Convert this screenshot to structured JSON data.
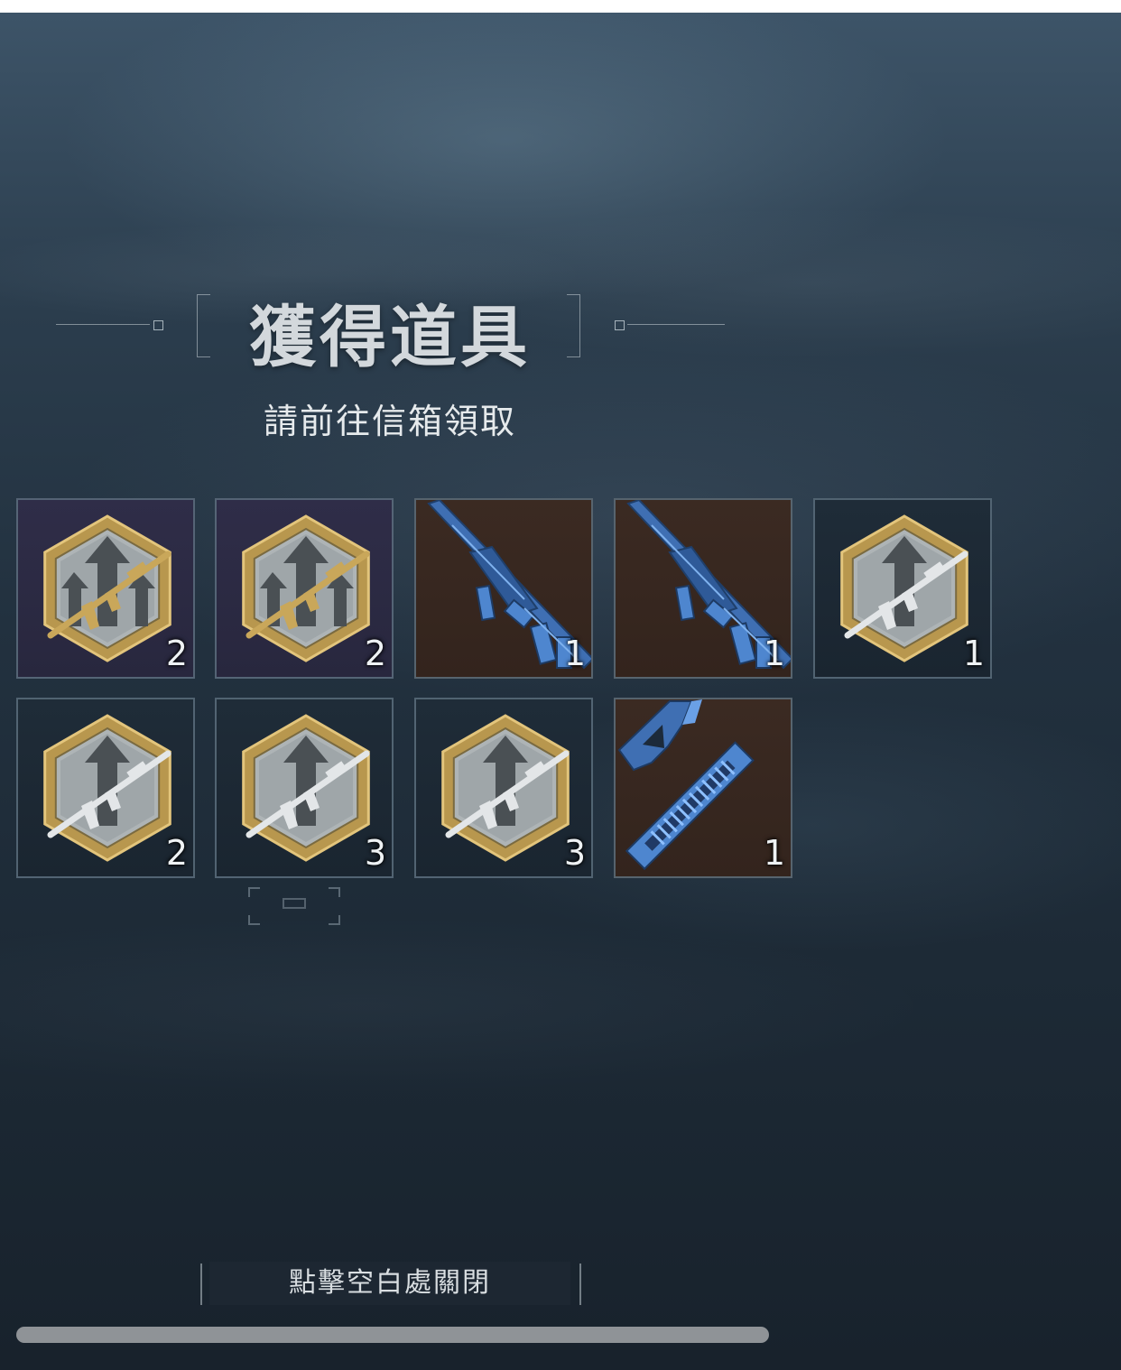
{
  "dialog": {
    "title": "獲得道具",
    "subtitle": "請前往信箱領取",
    "close_hint": "點擊空白處關閉"
  },
  "items": [
    {
      "name": "gold-rifle-upgrade-badge",
      "rarity_bg": "purple",
      "quantity": "2",
      "icon": "gold-upgrade-badge-icon"
    },
    {
      "name": "gold-rifle-upgrade-badge",
      "rarity_bg": "purple",
      "quantity": "2",
      "icon": "gold-upgrade-badge-icon"
    },
    {
      "name": "blue-camo-assault-rifle",
      "rarity_bg": "brown",
      "quantity": "1",
      "icon": "assault-rifle-icon"
    },
    {
      "name": "blue-camo-assault-rifle",
      "rarity_bg": "brown",
      "quantity": "1",
      "icon": "assault-rifle-icon"
    },
    {
      "name": "silver-rifle-upgrade-badge",
      "rarity_bg": "dark",
      "quantity": "1",
      "icon": "silver-upgrade-badge-icon"
    },
    {
      "name": "silver-rifle-upgrade-badge",
      "rarity_bg": "dark",
      "quantity": "2",
      "icon": "silver-upgrade-badge-icon"
    },
    {
      "name": "silver-rifle-upgrade-badge",
      "rarity_bg": "dark",
      "quantity": "3",
      "icon": "silver-upgrade-badge-icon"
    },
    {
      "name": "silver-rifle-upgrade-badge",
      "rarity_bg": "dark",
      "quantity": "3",
      "icon": "silver-upgrade-badge-icon"
    },
    {
      "name": "blue-tomahawk-axe",
      "rarity_bg": "brown",
      "quantity": "1",
      "icon": "tomahawk-axe-icon"
    }
  ],
  "colors": {
    "purple_slot": "#2f2d48",
    "brown_slot": "#3b2a22",
    "dark_slot": "#1f2c38",
    "gold": "#c9a75a",
    "weapon_blue": "#3f6fb3"
  }
}
